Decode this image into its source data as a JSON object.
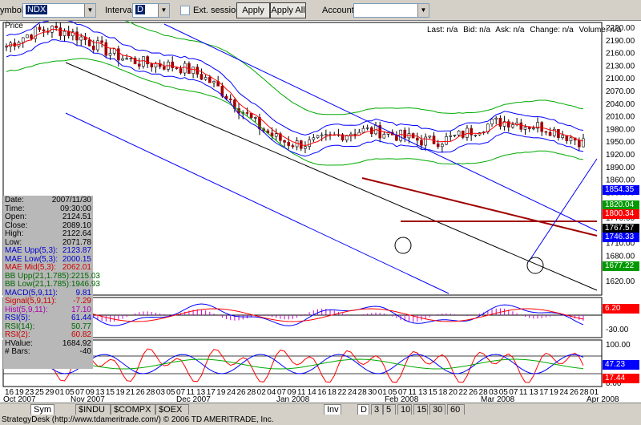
{
  "toolbar": {
    "symbol_label": "ymbol:",
    "symbol_value": "NDX",
    "interval_label": "Interval:",
    "interval_value": "D",
    "ext_session_label": "Ext. session",
    "apply_label": "Apply",
    "apply_all_label": "Apply All",
    "account_label": "Account:",
    "account_value": ""
  },
  "quote": {
    "last": "Last: n/a",
    "bid": "Bid: n/a",
    "ask": "Ask: n/a",
    "change": "Change: n/a",
    "volume": "Volume: n/a"
  },
  "price_title": "Price",
  "info": [
    {
      "label": "Date:",
      "value": "2007/11/30",
      "color": "#000000"
    },
    {
      "label": "Time:",
      "value": "09:30:00",
      "color": "#000000"
    },
    {
      "label": "Open:",
      "value": "2124.51",
      "color": "#000000"
    },
    {
      "label": "Close:",
      "value": "2089.10",
      "color": "#000000"
    },
    {
      "label": "High:",
      "value": "2122.64",
      "color": "#000000"
    },
    {
      "label": "Low:",
      "value": "2071.78",
      "color": "#000000"
    },
    {
      "label": "MAE Upp(5,3):",
      "value": "2123.87",
      "color": "#0000cc"
    },
    {
      "label": "MAE Low(5,3):",
      "value": "2000.15",
      "color": "#0000cc"
    },
    {
      "label": "MAE Mid(5,3):",
      "value": "2062.01",
      "color": "#cc0000"
    },
    {
      "label": "BB Upp(21,1.785):",
      "value": "2215.03",
      "color": "#006600"
    },
    {
      "label": "BB Low(21,1.785):",
      "value": "1946.93",
      "color": "#006600"
    },
    {
      "label": "MACD(5,9,11):",
      "value": "9.81",
      "color": "#0000cc"
    },
    {
      "label": "Signal(5,9,11):",
      "value": "-7.29",
      "color": "#cc0000"
    },
    {
      "label": "Hist(5,9,11):",
      "value": "17.10",
      "color": "#aa00aa"
    },
    {
      "label": "RSI(5):",
      "value": "61.44",
      "color": "#0000cc"
    },
    {
      "label": "RSI(14):",
      "value": "50.77",
      "color": "#006600"
    },
    {
      "label": "RSI(2):",
      "value": "60.82",
      "color": "#cc0000"
    },
    {
      "label": "HValue:",
      "value": "1684.92",
      "color": "#000000"
    },
    {
      "label": "# Bars:",
      "value": "-40",
      "color": "#000000"
    }
  ],
  "price_axis": [
    "2220.00",
    "2190.00",
    "2160.00",
    "2130.00",
    "2100.00",
    "2070.00",
    "2040.00",
    "2010.00",
    "1980.00",
    "1950.00",
    "1920.00",
    "1890.00",
    "1860.00",
    "1830.00",
    "1800.00",
    "1770.00",
    "1740.00",
    "1710.00",
    "1680.00",
    "1650.00",
    "1620.00"
  ],
  "price_tags": [
    {
      "value": "1854.35",
      "color": "#0000ff",
      "fg": "#ffffff"
    },
    {
      "value": "1820.04",
      "color": "#009900",
      "fg": "#ffffff"
    },
    {
      "value": "1800.34",
      "color": "#ff0000",
      "fg": "#ffffff"
    },
    {
      "value": "1767.57",
      "color": "#000000",
      "fg": "#ffffff"
    },
    {
      "value": "1746.33",
      "color": "#0000ff",
      "fg": "#ffffff"
    },
    {
      "value": "1677.22",
      "color": "#009900",
      "fg": "#ffffff"
    }
  ],
  "macd_axis": [
    "-30.00"
  ],
  "macd_tag": {
    "value": "6.20",
    "color": "#ff0000"
  },
  "rsi_axis": [
    "100.00",
    "0.00"
  ],
  "rsi_tags": [
    {
      "value": "47.23",
      "color": "#0000ff"
    },
    {
      "value": "17.44",
      "color": "#ff0000"
    }
  ],
  "x_days": [
    "16",
    "19",
    "23",
    "25",
    "29",
    "01",
    "05",
    "07",
    "09",
    "13",
    "15",
    "19",
    "21",
    "26",
    "28",
    "03",
    "05",
    "07",
    "11",
    "13",
    "17",
    "19",
    "24",
    "26",
    "28",
    "02",
    "04",
    "07",
    "09",
    "11",
    "14",
    "16",
    "18",
    "22",
    "24",
    "28",
    "30",
    "01",
    "05",
    "07",
    "11",
    "13",
    "15",
    "18",
    "20",
    "22",
    "26",
    "28",
    "03",
    "05",
    "07",
    "11",
    "13",
    "17",
    "19",
    "24",
    "26",
    "28",
    "01"
  ],
  "x_months": [
    "Oct 2007",
    "Nov 2007",
    "Dec 2007",
    "Jan 2008",
    "Feb 2008",
    "Mar 2008",
    "Apr 2008"
  ],
  "tabs": [
    "Sym",
    "$INDU",
    "$COMPX",
    "$OEX",
    "Inv",
    "D",
    "3",
    "5",
    "10",
    "15",
    "30",
    "60"
  ],
  "status": "StrategyDesk (http://www.tdameritrade.com/) © 2006 TD AMERITRADE, Inc."
}
